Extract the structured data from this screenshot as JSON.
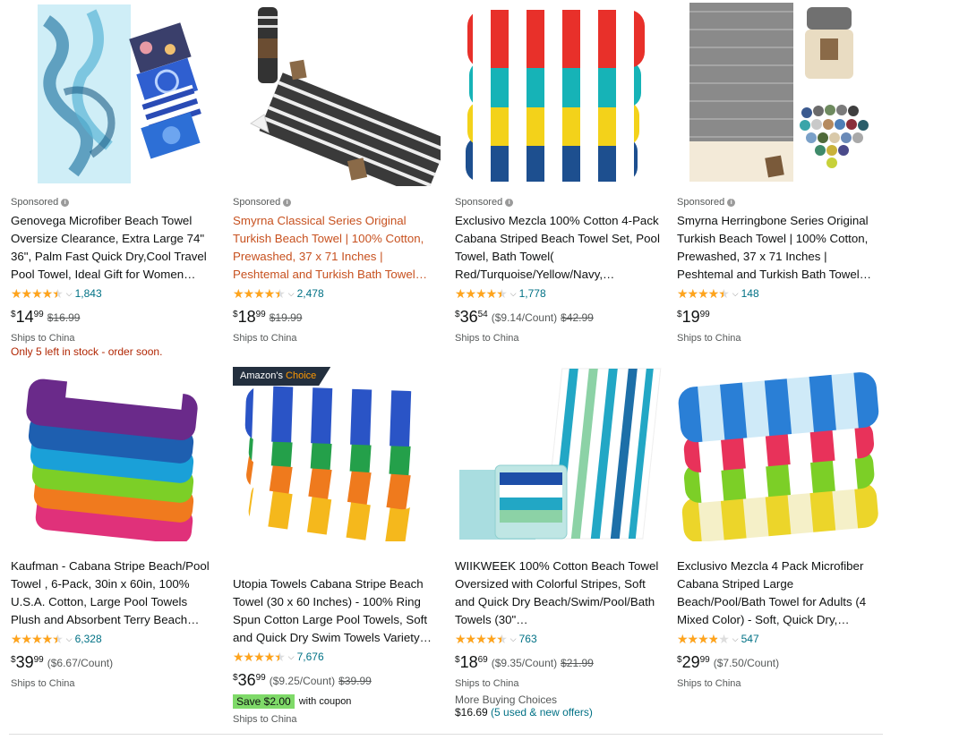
{
  "sponsored_label": "Sponsored",
  "badge": {
    "prefix": "Amazon's",
    "choice": "Choice"
  },
  "products": [
    {
      "title": "Genovega Microfiber Beach Towel Oversize Clearance, Extra Large 74\" 36\", Palm Fast Quick Dry,Cool Travel Pool Towel, Ideal Gift for Women…",
      "rating": 4.5,
      "reviews": "1,843",
      "price_symbol": "$",
      "price_whole": "14",
      "price_fraction": "99",
      "unit_price": "",
      "list_price": "$16.99",
      "ships": "Ships to China",
      "stock": "Only 5 left in stock - order soon."
    },
    {
      "title": "Smyrna Classical Series Original Turkish Beach Towel | 100% Cotton, Prewashed, 37 x 71 Inches | Peshtemal and Turkish Bath Towel…",
      "rating": 4.5,
      "reviews": "2,478",
      "price_symbol": "$",
      "price_whole": "18",
      "price_fraction": "99",
      "unit_price": "",
      "list_price": "$19.99",
      "ships": "Ships to China"
    },
    {
      "title": "Exclusivo Mezcla 100% Cotton 4-Pack Cabana Striped Beach Towel Set, Pool Towel, Bath Towel( Red/Turquoise/Yellow/Navy,…",
      "rating": 4.5,
      "reviews": "1,778",
      "price_symbol": "$",
      "price_whole": "36",
      "price_fraction": "54",
      "unit_price": "($9.14/Count)",
      "list_price": "$42.99",
      "ships": "Ships to China"
    },
    {
      "title": "Smyrna Herringbone Series Original Turkish Beach Towel | 100% Cotton, Prewashed, 37 x 71 Inches | Peshtemal and Turkish Bath Towel…",
      "rating": 4.5,
      "reviews": "148",
      "price_symbol": "$",
      "price_whole": "19",
      "price_fraction": "99",
      "unit_price": "",
      "list_price": "",
      "ships": "Ships to China"
    },
    {
      "title": "Kaufman - Cabana Stripe Beach/Pool Towel , 6-Pack, 30in x 60in, 100% U.S.A. Cotton, Large Pool Towels Plush and Absorbent Terry Beach…",
      "rating": 4.5,
      "reviews": "6,328",
      "price_symbol": "$",
      "price_whole": "39",
      "price_fraction": "99",
      "unit_price": "($6.67/Count)",
      "list_price": "",
      "ships": "Ships to China"
    },
    {
      "title": "Utopia Towels Cabana Stripe Beach Towel (30 x 60 Inches) - 100% Ring Spun Cotton Large Pool Towels, Soft and Quick Dry Swim Towels Variety…",
      "rating": 4.5,
      "reviews": "7,676",
      "price_symbol": "$",
      "price_whole": "36",
      "price_fraction": "99",
      "unit_price": "($9.25/Count)",
      "list_price": "$39.99",
      "ships": "Ships to China",
      "coupon_save": "Save $2.00",
      "coupon_with": "with coupon"
    },
    {
      "title": "WIIKWEEK 100% Cotton Beach Towel Oversized with Colorful Stripes, Soft and Quick Dry Beach/Swim/Pool/Bath Towels (30\"…",
      "rating": 4.5,
      "reviews": "763",
      "price_symbol": "$",
      "price_whole": "18",
      "price_fraction": "69",
      "unit_price": "($9.35/Count)",
      "list_price": "$21.99",
      "ships": "Ships to China",
      "more_choices": "More Buying Choices",
      "used_price": "$16.69",
      "used_link": "(5 used & new offers)"
    },
    {
      "title": "Exclusivo Mezcla 4 Pack Microfiber Cabana Striped Large Beach/Pool/Bath Towel for Adults (4 Mixed Color) - Soft, Quick Dry,…",
      "rating": 4.0,
      "reviews": "547",
      "price_symbol": "$",
      "price_whole": "29",
      "price_fraction": "99",
      "unit_price": "($7.50/Count)",
      "list_price": "",
      "ships": "Ships to China"
    }
  ]
}
